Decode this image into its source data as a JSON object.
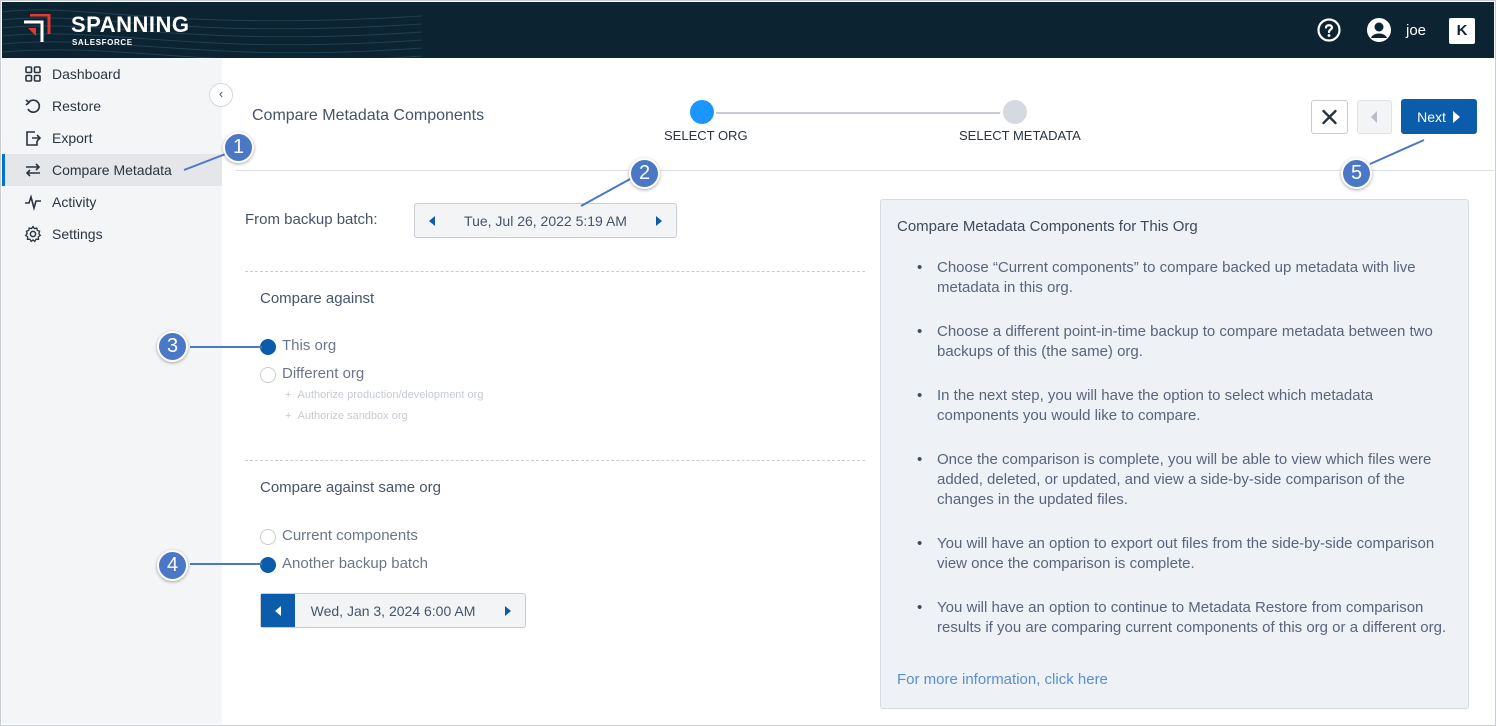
{
  "app": {
    "brand": "SPANNING",
    "brand_sub": "SALESFORCE",
    "user_name": "joe",
    "partner_logo": "K"
  },
  "sidebar": {
    "items": [
      {
        "label": "Dashboard",
        "icon": "grid-icon"
      },
      {
        "label": "Restore",
        "icon": "undo-icon"
      },
      {
        "label": "Export",
        "icon": "export-icon"
      },
      {
        "label": "Compare Metadata",
        "icon": "compare-arrows-icon",
        "active": true
      },
      {
        "label": "Activity",
        "icon": "pulse-icon"
      },
      {
        "label": "Settings",
        "icon": "gear-icon"
      }
    ],
    "collapse_glyph": "‹"
  },
  "page": {
    "title": "Compare Metadata Components"
  },
  "stepper": {
    "steps": [
      {
        "label": "SELECT ORG",
        "active": true
      },
      {
        "label": "SELECT METADATA",
        "active": false
      }
    ]
  },
  "toolbar": {
    "next_label": "Next"
  },
  "form": {
    "from_label": "From backup batch:",
    "from_date": "Tue, Jul 26, 2022 5:19 AM",
    "compare_against_label": "Compare against",
    "options": [
      {
        "label": "This org",
        "selected": true
      },
      {
        "label": "Different org",
        "selected": false
      }
    ],
    "sub_links": [
      "Authorize production/development org",
      "Authorize sandbox org"
    ],
    "same_org_label": "Compare against same org",
    "same_org_options": [
      {
        "label": "Current components",
        "selected": false
      },
      {
        "label": "Another backup batch",
        "selected": true
      }
    ],
    "other_date": "Wed, Jan 3, 2024 6:00 AM"
  },
  "info": {
    "title": "Compare Metadata Components for This Org",
    "bullets": [
      "Choose “Current components” to compare backed up metadata with live metadata in this org.",
      "Choose a different point-in-time backup to compare metadata between two backups of this (the same) org.",
      "In the next step, you will have the option to select which metadata components you would like to compare.",
      "Once the comparison is complete, you will be able to view which files were added, deleted, or updated, and view a side-by-side comparison of the changes in the updated files.",
      "You will have an option to export out files from the side-by-side comparison view once the comparison is complete.",
      "You will have an option to continue to Metadata Restore from comparison results if you are comparing current components of this org or a different org."
    ],
    "link": "For more information, click here"
  },
  "callouts": [
    "1",
    "2",
    "3",
    "4",
    "5"
  ],
  "colors": {
    "header_bg": "#0c2332",
    "primary": "#0b5cab",
    "active_step": "#1b96ff",
    "callout": "#4a78c6",
    "panel_bg": "#eef1f6"
  }
}
